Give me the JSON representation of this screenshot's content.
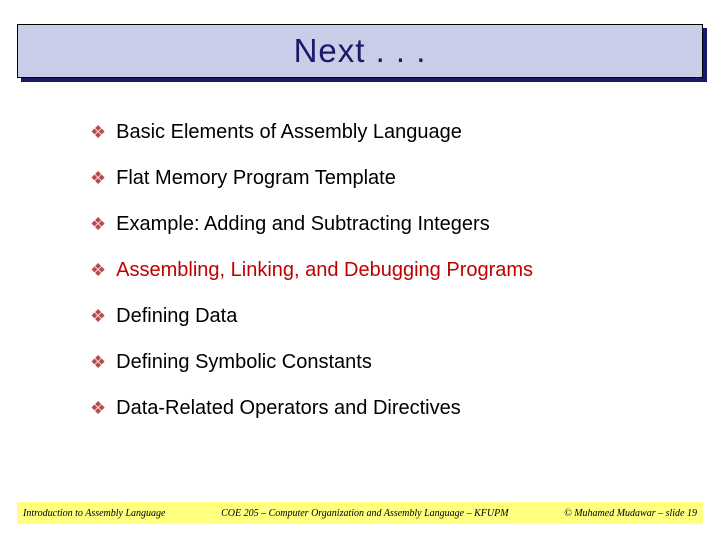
{
  "title": "Next . . .",
  "items": [
    {
      "text": "Basic Elements of Assembly Language",
      "highlight": false
    },
    {
      "text": "Flat Memory Program Template",
      "highlight": false
    },
    {
      "text": "Example: Adding and Subtracting Integers",
      "highlight": false
    },
    {
      "text": "Assembling, Linking, and Debugging Programs",
      "highlight": true
    },
    {
      "text": "Defining Data",
      "highlight": false
    },
    {
      "text": "Defining Symbolic Constants",
      "highlight": false
    },
    {
      "text": "Data-Related Operators and Directives",
      "highlight": false
    }
  ],
  "bullet_glyph": "❖",
  "footer": {
    "left": "Introduction to Assembly Language",
    "center": "COE 205 – Computer Organization and Assembly Language – KFUPM",
    "right": "© Muhamed Mudawar – slide 19"
  }
}
